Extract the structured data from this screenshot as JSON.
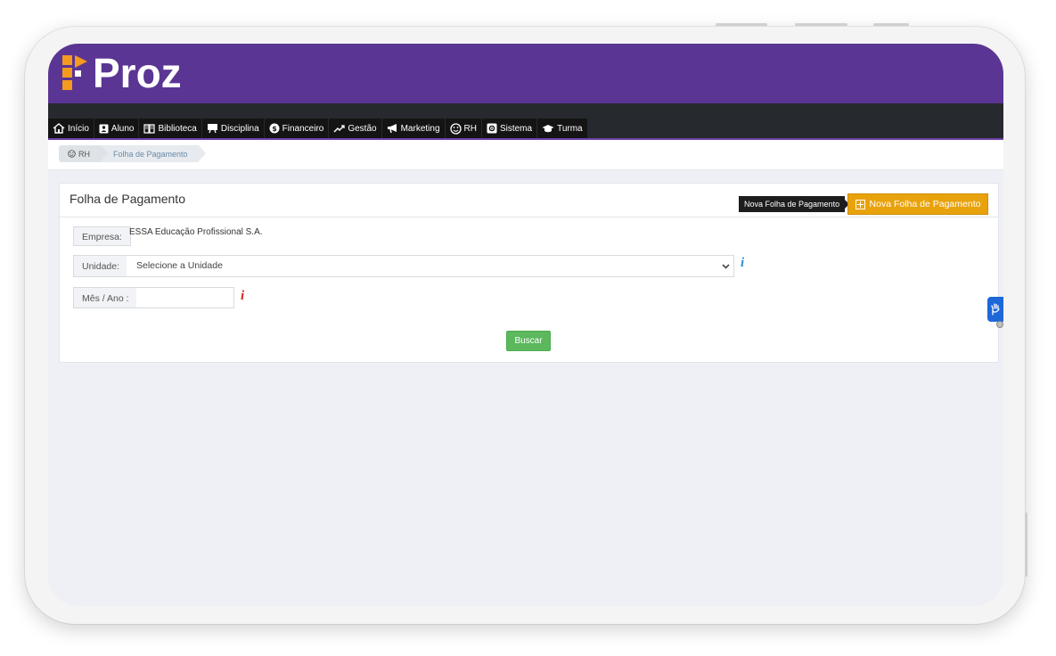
{
  "app": {
    "logo_text": "Proz"
  },
  "nav": {
    "items": [
      {
        "label": "Início",
        "icon": "home-icon"
      },
      {
        "label": "Aluno",
        "icon": "id-card-icon"
      },
      {
        "label": "Biblioteca",
        "icon": "book-icon"
      },
      {
        "label": "Disciplina",
        "icon": "easel-icon"
      },
      {
        "label": "Financeiro",
        "icon": "dollar-icon"
      },
      {
        "label": "Gestão",
        "icon": "trend-icon"
      },
      {
        "label": "Marketing",
        "icon": "megaphone-icon"
      },
      {
        "label": "RH",
        "icon": "smile-icon"
      },
      {
        "label": "Sistema",
        "icon": "cog-box-icon"
      },
      {
        "label": "Turma",
        "icon": "graduation-cap-icon"
      }
    ]
  },
  "breadcrumb": {
    "items": [
      "RH",
      "Folha de Pagamento"
    ]
  },
  "panel": {
    "title": "Folha de Pagamento",
    "tooltip": "Nova Folha de Pagamento",
    "new_button_label": "Nova Folha de Pagamento"
  },
  "form": {
    "empresa_label": "Empresa:",
    "empresa_value": "ESSA Educação Profissional S.A.",
    "unidade_label": "Unidade:",
    "unidade_selected": "Selecione a Unidade",
    "mes_ano_label": "Mês / Ano :",
    "mes_ano_value": "",
    "info_symbol": "i",
    "search_label": "Buscar"
  },
  "colors": {
    "brand_purple": "#5b3593",
    "nav_dark": "#26292e",
    "accent_orange": "#e8a20c",
    "success_green": "#5cb85c",
    "info_blue": "#2a8fcf",
    "required_red": "#d9231d"
  }
}
